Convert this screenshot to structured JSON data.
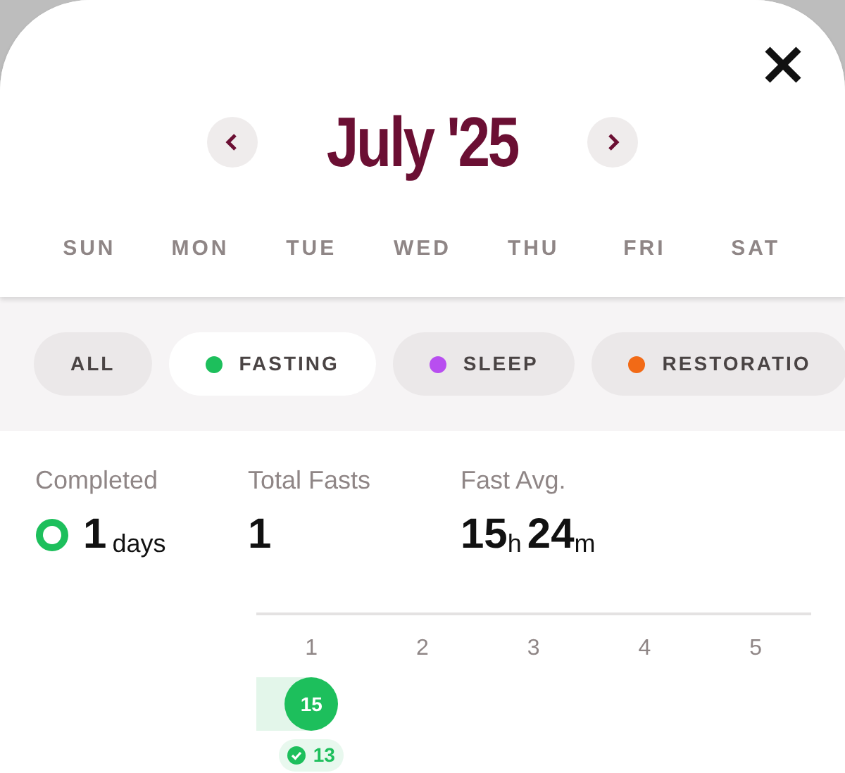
{
  "header": {
    "title": "July '25"
  },
  "weekdays": [
    "SUN",
    "MON",
    "TUE",
    "WED",
    "THU",
    "FRI",
    "SAT"
  ],
  "filters": [
    {
      "label": "ALL",
      "selected": false
    },
    {
      "label": "FASTING",
      "selected": true,
      "color": "#1dbf5c"
    },
    {
      "label": "SLEEP",
      "selected": false,
      "color": "#b84ef0"
    },
    {
      "label": "RESTORATIO",
      "selected": false,
      "color": "#f26a16"
    }
  ],
  "stats": {
    "completed": {
      "label": "Completed",
      "value": "1",
      "unit": "days"
    },
    "total": {
      "label": "Total Fasts",
      "value": "1"
    },
    "average": {
      "label": "Fast Avg.",
      "hours": "15",
      "hours_unit": "h",
      "minutes": "24",
      "minutes_unit": "m"
    }
  },
  "calendar": {
    "days": [
      {
        "label": "1",
        "kind": "fast",
        "value": "15",
        "completed": "13"
      },
      {
        "label": "2",
        "kind": "empty"
      },
      {
        "label": "3",
        "kind": "empty"
      },
      {
        "label": "4",
        "kind": "empty"
      },
      {
        "label": "5",
        "kind": "empty"
      }
    ]
  }
}
